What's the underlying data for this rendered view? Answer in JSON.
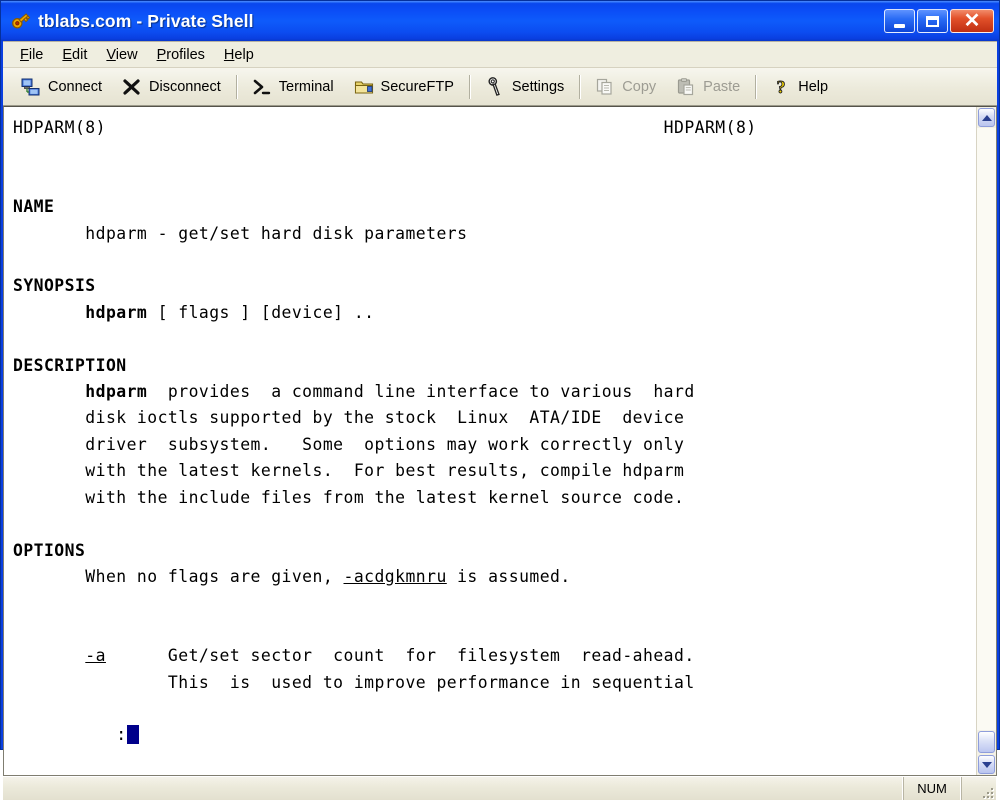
{
  "window": {
    "title": "tblabs.com - Private Shell",
    "icon": "key-icon",
    "controls": {
      "minimize_label": "Minimize",
      "maximize_label": "Maximize",
      "close_label": "Close"
    }
  },
  "menubar": {
    "items": [
      {
        "label": "File",
        "accel": "F"
      },
      {
        "label": "Edit",
        "accel": "E"
      },
      {
        "label": "View",
        "accel": "V"
      },
      {
        "label": "Profiles",
        "accel": "P"
      },
      {
        "label": "Help",
        "accel": "H"
      }
    ]
  },
  "toolbar": {
    "buttons": [
      {
        "label": "Connect",
        "icon": "network-computer-icon",
        "enabled": true
      },
      {
        "label": "Disconnect",
        "icon": "x-mark-icon",
        "enabled": true
      },
      {
        "label": "Terminal",
        "icon": "command-prompt-icon",
        "enabled": true
      },
      {
        "label": "SecureFTP",
        "icon": "folder-icon",
        "enabled": true
      },
      {
        "label": "Settings",
        "icon": "wrench-icon",
        "enabled": true
      },
      {
        "label": "Copy",
        "icon": "copy-icon",
        "enabled": false
      },
      {
        "label": "Paste",
        "icon": "paste-icon",
        "enabled": false
      },
      {
        "label": "Help",
        "icon": "question-mark-icon",
        "enabled": true
      }
    ]
  },
  "terminal": {
    "content": "HDPARM(8)                                                      HDPARM(8)\n\n\nNAME\n       hdparm - get/set hard disk parameters\n\nSYNOPSIS\n       hdparm [ flags ] [device] ..\n\nDESCRIPTION\n       hdparm  provides  a command line interface to various  hard\n       disk ioctls supported by the stock  Linux  ATA/IDE  device\n       driver  subsystem.   Some  options may work correctly only\n       with the latest kernels.  For best results, compile hdparm\n       with the include files from the latest kernel source code.\n\nOPTIONS\n       When no flags are given, -acdgkmnru is assumed.\n\n\n       -a      Get/set sector  count  for  filesystem  read-ahead.\n               This  is  used to improve performance in sequential",
    "lines": [
      {
        "text": "HDPARM(8)",
        "right": "HDPARM(8)",
        "style": "normal"
      },
      {
        "text": "",
        "style": "normal"
      },
      {
        "text": "",
        "style": "normal"
      },
      {
        "text": "NAME",
        "style": "bold"
      },
      {
        "text": "       hdparm - get/set hard disk parameters",
        "style": "normal"
      },
      {
        "text": "",
        "style": "normal"
      },
      {
        "text": "SYNOPSIS",
        "style": "bold"
      },
      {
        "text": "       hdparm [ flags ] [device] ..",
        "style": "mixed-bold-keyword"
      },
      {
        "text": "",
        "style": "normal"
      },
      {
        "text": "DESCRIPTION",
        "style": "bold"
      },
      {
        "text": "       hdparm  provides  a command line interface to various  hard",
        "style": "mixed-bold-keyword"
      },
      {
        "text": "       disk ioctls supported by the stock  Linux  ATA/IDE  device",
        "style": "normal"
      },
      {
        "text": "       driver  subsystem.   Some  options may work correctly only",
        "style": "normal"
      },
      {
        "text": "       with the latest kernels.  For best results, compile hdparm",
        "style": "normal"
      },
      {
        "text": "       with the include files from the latest kernel source code.",
        "style": "normal"
      },
      {
        "text": "",
        "style": "normal"
      },
      {
        "text": "OPTIONS",
        "style": "bold"
      },
      {
        "text": "       When no flags are given, -acdgkmnru is assumed.",
        "style": "mixed-underline"
      },
      {
        "text": "",
        "style": "normal"
      },
      {
        "text": "       -a      Get/set sector  count  for  filesystem  read-ahead.",
        "style": "mixed-underline"
      },
      {
        "text": "               This  is  used to improve performance in sequential",
        "style": "normal"
      }
    ],
    "header_left": "HDPARM(8)",
    "header_right": "HDPARM(8)",
    "prompt": ":",
    "cursor": "block",
    "cursor_color": "#00008b",
    "background": "#ffffff",
    "foreground": "#000000"
  },
  "scrollbar": {
    "up_label": "Scroll up",
    "down_label": "Scroll down",
    "thumb_label": "Scroll thumb"
  },
  "statusbar": {
    "message": "",
    "num_lock": "NUM",
    "grip": "resize-grip"
  },
  "colors": {
    "titlebar": "#0b4cf6",
    "close_button": "#d63b17",
    "client": "#ece9d8",
    "terminal_bg": "#ffffff",
    "cursor": "#00008b"
  }
}
